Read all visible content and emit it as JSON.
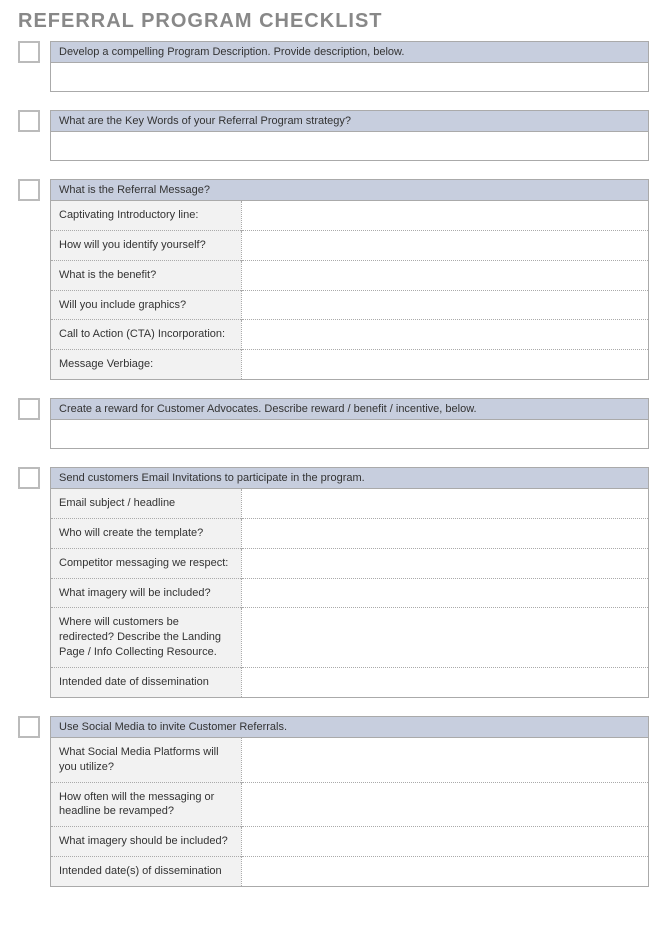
{
  "title": "REFERRAL PROGRAM CHECKLIST",
  "sections": [
    {
      "header": "Develop a compelling Program Description.  Provide description, below.",
      "freeResponse": true
    },
    {
      "header": "What are the Key Words of your Referral Program strategy?",
      "freeResponse": true
    },
    {
      "header": "What is the Referral Message?",
      "rows": [
        "Captivating Introductory line:",
        "How will you identify yourself?",
        "What is the benefit?",
        "Will you include graphics?",
        "Call to Action (CTA) Incorporation:",
        "Message Verbiage:"
      ]
    },
    {
      "header": "Create a reward for Customer Advocates.  Describe reward / benefit / incentive, below.",
      "freeResponse": true
    },
    {
      "header": "Send customers Email Invitations to participate in the program.",
      "rows": [
        "Email subject / headline",
        "Who will create the template?",
        "Competitor messaging we respect:",
        "What imagery will be included?",
        "Where will customers be redirected? Describe the Landing Page / Info Collecting Resource.",
        "Intended date of dissemination"
      ]
    },
    {
      "header": "Use Social Media to invite Customer Referrals.",
      "rows": [
        "What Social Media Platforms will you utilize?",
        "How often will the messaging or headline be revamped?",
        "What imagery should be included?",
        "Intended date(s) of dissemination"
      ]
    }
  ]
}
